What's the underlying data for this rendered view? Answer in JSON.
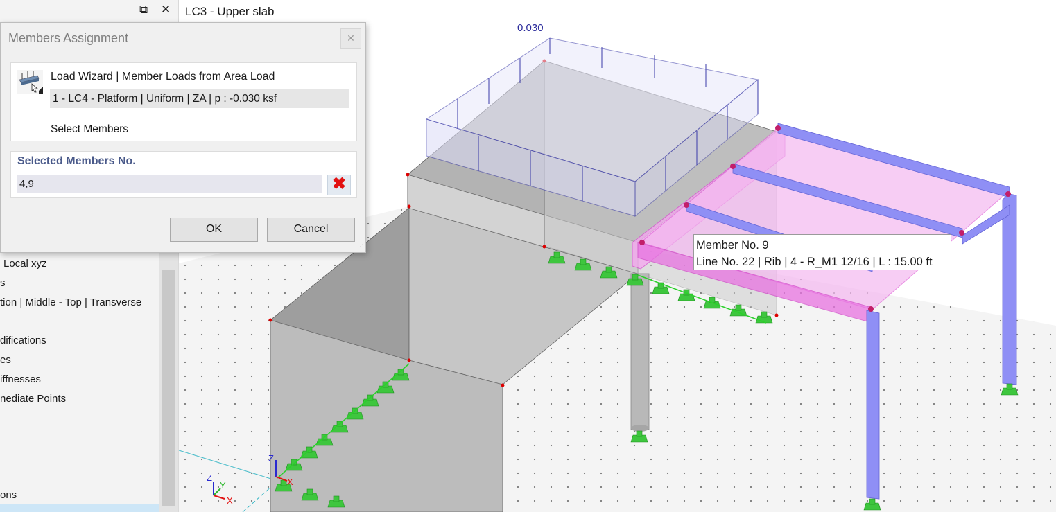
{
  "view_title": "LC3 - Upper slab",
  "navigator": {
    "items": [
      "Local xyz",
      "s",
      "tion | Middle - Top | Transverse",
      "difications",
      "es",
      "iffnesses",
      "nediate Points",
      "ons"
    ]
  },
  "dialog": {
    "title": "Members Assignment",
    "wizard_title": "Load Wizard | Member Loads from Area Load",
    "wizard_value": "1 - LC4 - Platform | Uniform | ZA | p : -0.030 ksf",
    "select_members": "Select Members",
    "selected_label": "Selected Members No.",
    "selected_value": "4,9",
    "ok": "OK",
    "cancel": "Cancel"
  },
  "tooltip": {
    "line1": "Member No. 9",
    "line2": "Line No. 22 | Rib | 4 - R_M1 12/16 | L : 15.00 ft"
  },
  "viewport": {
    "load_value": "0.030",
    "axes": {
      "x": "X",
      "y": "Y",
      "z": "Z"
    }
  },
  "icons": [
    "restore-window-icon",
    "close-icon",
    "load-wizard-icon",
    "delete-x-icon"
  ],
  "colors": {
    "member_highlight": "#f2b3ef",
    "member_blue": "#8f8ff5",
    "support_green": "#3ec63e",
    "load_blue": "#3a3aa8"
  }
}
